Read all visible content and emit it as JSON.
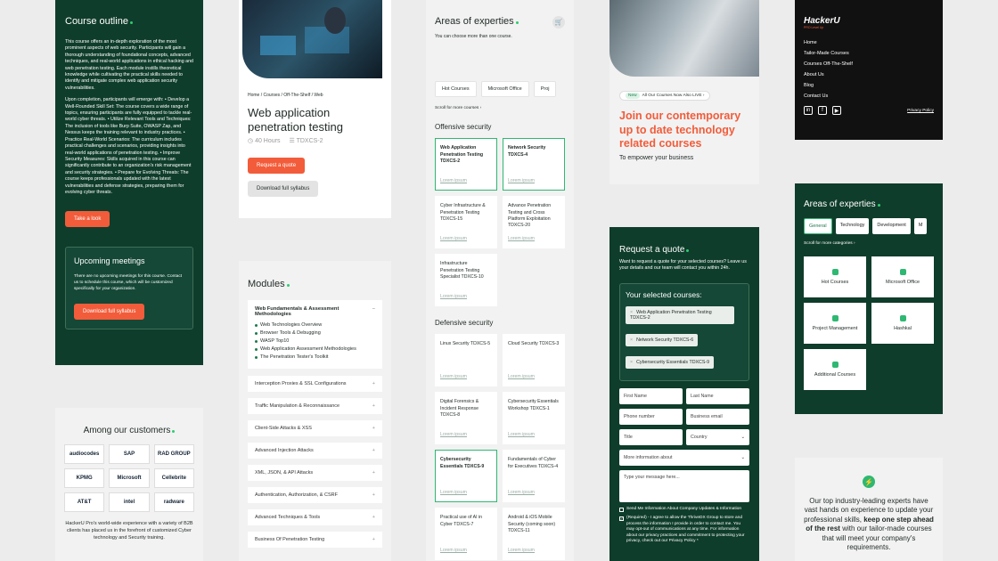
{
  "outline": {
    "title": "Course outline",
    "p1": "This course offers an in-depth exploration of the most prominent aspects of web security. Participants will gain a thorough understanding of foundational concepts, advanced techniques, and real-world applications in ethical hacking and web penetration testing. Each module instills theoretical knowledge while cultivating the practical skills needed to identify and mitigate complex web application security vulnerabilities.",
    "p2": "Upon completion, participants will emerge with: • Develop a Well-Rounded Skill Set: The course covers a wide range of topics, ensuring participants are fully equipped to tackle real-world cyber threats. • Utilize Relevant Tools and Techniques: The inclusion of tools like Burp Suite, OWASP Zap, and Nessus keeps the training relevant to industry practices. • Practice Real-World Scenarios: The curriculum includes practical challenges and scenarios, providing insights into real-world applications of penetration testing. • Improve Security Measures: Skills acquired in this course can significantly contribute to an organization's risk management and security strategies. • Prepare for Evolving Threats: The course keeps professionals updated with the latest vulnerabilities and defense strategies, preparing them for evolving cyber threats.",
    "cta": "Take a look",
    "meetings_title": "Upcoming meetings",
    "meetings_text": "There are no upcoming meetings for this course. Contact us to schedule this course, which will be customized specifically for your organization.",
    "meetings_cta": "Download full syllabus"
  },
  "customers": {
    "title": "Among our customers",
    "logos": [
      "audiocodes",
      "SAP",
      "RAD GROUP",
      "KPMG",
      "Microsoft",
      "Cellebrite",
      "AT&T",
      "intel",
      "radware"
    ],
    "text": "HackerU Pro's world-wide experience with a variety of B2B clients has placed us in the forefront of customized Cyber technology and Security training."
  },
  "course": {
    "breadcrumb": "Home / Courses / Off-The-Shelf / Web",
    "title": "Web application penetration testing",
    "hours": "40 Hours",
    "code": "TDXCS-2",
    "quote_btn": "Request a quote",
    "syllabus_btn": "Download full syllabus"
  },
  "modules": {
    "title": "Modules",
    "open_title": "Web Fundamentals & Assessment Methodologies",
    "open_items": [
      "Web Technologies Overview",
      "Browser Tools & Debugging",
      "WASP Top10",
      "Web Application Assessment Methodologies",
      "The Penetration Tester's Toolkit"
    ],
    "items": [
      "Interception Proxies & SSL Configurations",
      "Traffic Manipulation & Reconnaissance",
      "Client-Side Attacks & XSS",
      "Advanced Injection Attacks",
      "XML, JSON, & API Attacks",
      "Authentication, Authorization, & CSRF",
      "Advanced Techniques & Tools",
      "Business Of Penetration Testing"
    ]
  },
  "expertise": {
    "title": "Areas of experties",
    "subtitle": "You can choose more than one course.",
    "chips": [
      "Hot Courses",
      "Microsoft Office",
      "Proj"
    ],
    "scroll": "Scroll for more courses ›",
    "offensive_title": "Offensive security",
    "offensive": [
      {
        "name": "Web Application Penetration Testing TDXCS-2",
        "sel": true
      },
      {
        "name": "Network Security TDXCS-4",
        "sel": true
      },
      {
        "name": "Cyber Infrastructure & Penetration Testing TDXCS-15",
        "sel": false
      },
      {
        "name": "Advance Penetration Testing and Cross Platform Exploitation TDXCS-20",
        "sel": false
      },
      {
        "name": "Infrastructure Penetration Testing Specialist TDXCS-10",
        "sel": false
      }
    ],
    "defensive_title": "Defensive security",
    "defensive": [
      {
        "name": "Linux Security TDXCS-5",
        "sel": false
      },
      {
        "name": "Cloud Security TDXCS-3",
        "sel": false
      },
      {
        "name": "Digital Forensics & Incident Response TDXCS-8",
        "sel": false
      },
      {
        "name": "Cybersecurity Essentials Workshop TDXCS-1",
        "sel": false
      },
      {
        "name": "Cybersecurity Essentials TDXCS-9",
        "sel": true
      },
      {
        "name": "Fundamentals of Cyber for Executives TDXCS-4",
        "sel": false
      },
      {
        "name": "Practical use of AI in Cyber TDXCS-7",
        "sel": false
      },
      {
        "name": "Android & iOS Mobile Security (coming soon) TDXCS-11",
        "sel": false
      }
    ],
    "link": "Lorem ipsum"
  },
  "promo": {
    "badge_new": "New",
    "badge_text": "All Our Courses Now Also LIVE ›",
    "title_accent": "Join our",
    "title_rest": " contemporary up to date technology related courses",
    "sub": "To empower your business"
  },
  "quote": {
    "title": "Request a quote",
    "text": "Want to request a quote for your selected courses? Leave us your details and our team will contact you within 24h.",
    "selected_title": "Your selected courses:",
    "selected": [
      "Web Application Penetration Testing TDXCS-2",
      "Network Security TDXCS-6",
      "Cybersecurity Essentials TDXCS-9"
    ],
    "first": "First Name",
    "last": "Last Name",
    "phone": "Phone number",
    "email": "Business email",
    "jobtitle": "Title",
    "country": "Country",
    "more": "More information about",
    "message": "Type your message here...",
    "chk1": "Send Me Information About Company Updates & Information",
    "chk2": "(Required) - I agree to allow the ThriveDX Group to store and process the information I provide in order to contact me. You may opt-out of communications at any time. For information about our privacy practices and commitment to protecting your privacy, check out our Privacy Policy *"
  },
  "footer": {
    "brand": "HackerU",
    "tag": "PRO Level Up",
    "links": [
      "Home",
      "Tailor-Made Courses",
      "Courses Off-The-Shelf",
      "About Us",
      "Blog",
      "Contact Us"
    ],
    "privacy": "Privacy Policy"
  },
  "areas2": {
    "title": "Areas of experties",
    "tabs": [
      "General",
      "Technology",
      "Development",
      "M"
    ],
    "scroll": "Scroll for more categories ›",
    "tiles": [
      "Hot Courses",
      "Microsoft Office",
      "Project Management",
      "Hashkal",
      "Additional Courses"
    ]
  },
  "experts": {
    "pre": "Our top industry-leading experts have vast hands on experience to update your professional skills, ",
    "bold": "keep one step ahead of the rest",
    "post": " with our tailor-made courses that will meet your company's requirements."
  },
  "colors": {
    "green": "#0f3d2b",
    "accent": "#f25c3a",
    "highlight": "#2eb872"
  }
}
